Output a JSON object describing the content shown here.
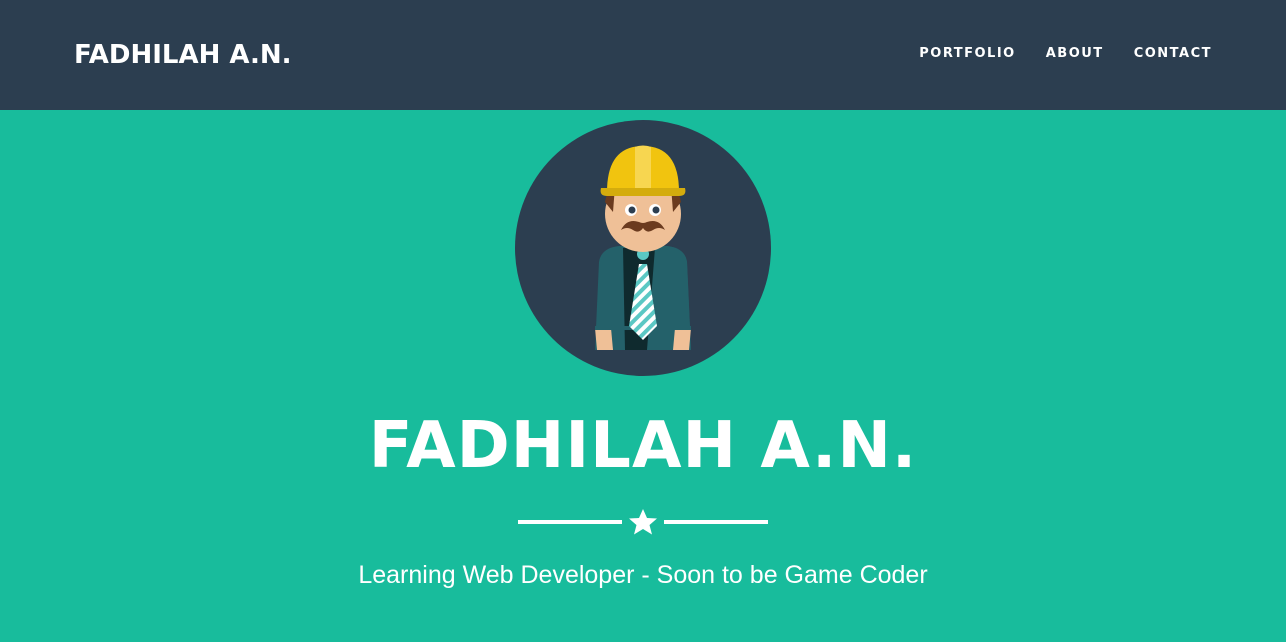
{
  "navbar": {
    "brand": "FADHILAH A.N.",
    "items": [
      {
        "label": "PORTFOLIO"
      },
      {
        "label": "ABOUT"
      },
      {
        "label": "CONTACT"
      }
    ]
  },
  "header": {
    "avatar_icon": "profile-avatar-construction-worker",
    "name": "FADHILAH A.N.",
    "divider_icon": "star-icon",
    "tagline": "Learning Web Developer - Soon to be Game Coder"
  },
  "colors": {
    "navbar_bg": "#2c3e50",
    "header_bg": "#18bc9c",
    "text": "#ffffff"
  }
}
